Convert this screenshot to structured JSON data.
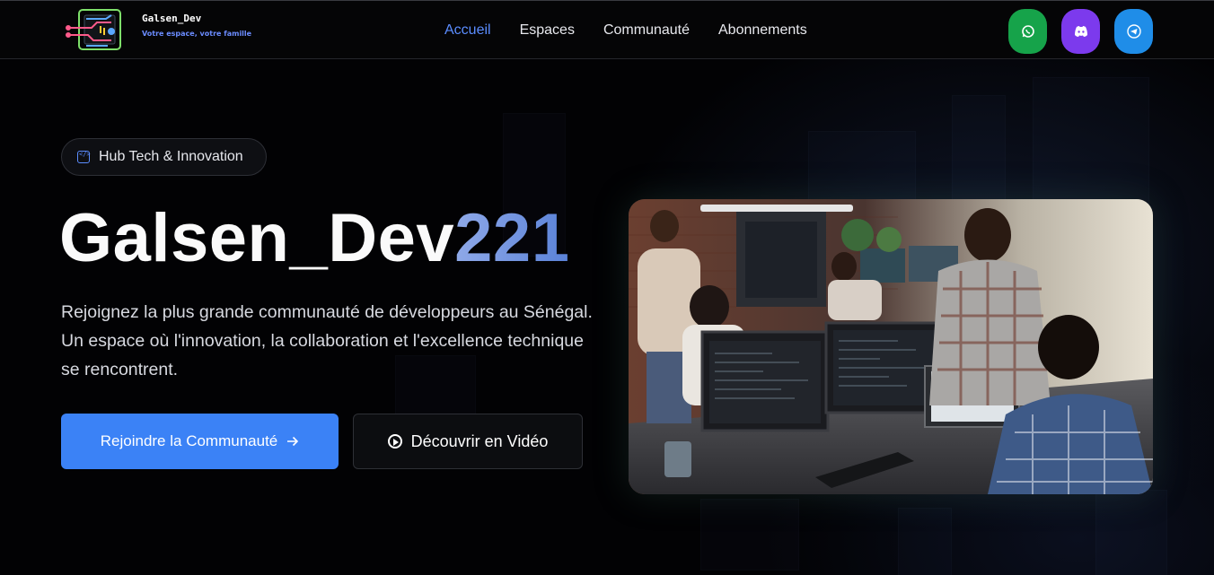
{
  "brand": {
    "name": "Galsen_Dev",
    "tagline": "Votre espace, votre famille"
  },
  "nav": {
    "items": [
      {
        "label": "Accueil",
        "active": true
      },
      {
        "label": "Espaces",
        "active": false
      },
      {
        "label": "Communauté",
        "active": false
      },
      {
        "label": "Abonnements",
        "active": false
      }
    ]
  },
  "socials": [
    {
      "icon": "whatsapp-icon",
      "color": "#16a34a"
    },
    {
      "icon": "discord-icon",
      "color": "#7c3aed"
    },
    {
      "icon": "telegram-icon",
      "color": "#1f8de8"
    }
  ],
  "hero": {
    "badge": "Hub Tech & Innovation",
    "title_prefix": "Galsen_Dev",
    "title_highlight": "221",
    "description": "Rejoignez la plus grande communauté de développeurs au Sénégal. Un espace où l'innovation, la collaboration et l'excellence technique se rencontrent.",
    "primary_button": "Rejoindre la Communauté",
    "secondary_button": "Découvrir en Vidéo"
  },
  "colors": {
    "accent": "#3b82f6",
    "nav_active": "#5b8dff",
    "background": "#020204"
  }
}
